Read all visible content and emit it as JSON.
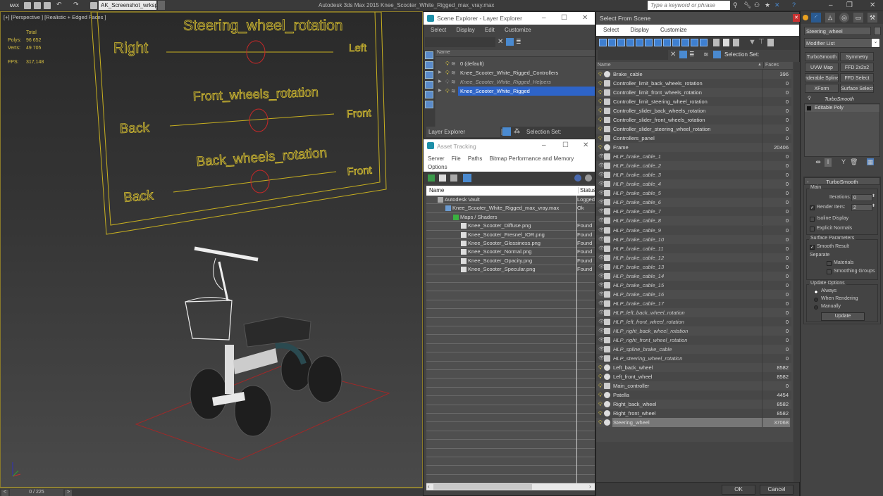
{
  "app": {
    "title": "Autodesk 3ds Max  2015    Knee_Scooter_White_Rigged_max_vray.max",
    "workspace": "AK_Screenshot_wrksp",
    "search_placeholder": "Type a keyword or phrase",
    "logo_text": "MAX"
  },
  "viewport": {
    "label": "[+] [Perspective ] [Realistic + Edged Faces ]",
    "stats": {
      "header": "Total",
      "polys_label": "Polys:",
      "polys": "96 652",
      "verts_label": "Verts:",
      "verts": "49 705",
      "fps_label": "FPS:",
      "fps": "317,148"
    },
    "panel": {
      "steering_title": "Steering_wheel_rotation",
      "steering_left": "Right",
      "steering_right": "Left",
      "front_title": "Front_wheels_rotation",
      "front_left": "Back",
      "front_right": "Front",
      "back_title": "Back_wheels_rotation",
      "back_left": "Back",
      "back_right": "Front"
    },
    "timeline": {
      "frame": "0 / 225",
      "prev": "<",
      "next": ">"
    }
  },
  "scene_explorer": {
    "title": "Scene Explorer - Layer Explorer",
    "menu": [
      "Select",
      "Display",
      "Edit",
      "Customize"
    ],
    "column_name": "Name",
    "layers": [
      {
        "name": "0 (default)",
        "expandable": false,
        "hidden": false,
        "selected": false
      },
      {
        "name": "Knee_Scooter_White_Rigged_Controllers",
        "expandable": true,
        "hidden": false,
        "selected": false
      },
      {
        "name": "Knee_Scooter_White_Rigged_Helpers",
        "expandable": true,
        "hidden": true,
        "selected": false
      },
      {
        "name": "Knee_Scooter_White_Rigged",
        "expandable": true,
        "hidden": false,
        "selected": true
      }
    ],
    "footer_mode": "Layer Explorer",
    "footer_selset": "Selection Set:"
  },
  "asset_tracking": {
    "title": "Asset Tracking",
    "menu": [
      "Server",
      "File",
      "Paths",
      "Bitmap Performance and Memory",
      "Options"
    ],
    "columns": [
      "Name",
      "Status"
    ],
    "rows": [
      {
        "name": "Autodesk Vault",
        "status": "Logged",
        "indent": 0,
        "icon": "vault"
      },
      {
        "name": "Knee_Scooter_White_Rigged_max_vray.max",
        "status": "Ok",
        "indent": 1,
        "icon": "max-file"
      },
      {
        "name": "Maps / Shaders",
        "status": "",
        "indent": 2,
        "icon": "folder"
      },
      {
        "name": "Knee_Scooter_Diffuse.png",
        "status": "Found",
        "indent": 3,
        "icon": "image"
      },
      {
        "name": "Knee_Scooter_Fresnel_IOR.png",
        "status": "Found",
        "indent": 3,
        "icon": "image"
      },
      {
        "name": "Knee_Scooter_Glossiness.png",
        "status": "Found",
        "indent": 3,
        "icon": "image"
      },
      {
        "name": "Knee_Scooter_Normal.png",
        "status": "Found",
        "indent": 3,
        "icon": "image"
      },
      {
        "name": "Knee_Scooter_Opacity.png",
        "status": "Found",
        "indent": 3,
        "icon": "image"
      },
      {
        "name": "Knee_Scooter_Specular.png",
        "status": "Found",
        "indent": 3,
        "icon": "image"
      }
    ]
  },
  "select_from_scene": {
    "title": "Select From Scene",
    "menu": [
      "Select",
      "Display",
      "Customize"
    ],
    "selection_set_label": "Selection Set:",
    "columns": [
      "Name",
      "Faces"
    ],
    "objects": [
      {
        "name": "Brake_cable",
        "faces": "396",
        "type": "geometry"
      },
      {
        "name": "Controller_limit_back_wheels_rotation",
        "faces": "0",
        "type": "shape"
      },
      {
        "name": "Controller_limit_front_wheels_rotation",
        "faces": "0",
        "type": "shape"
      },
      {
        "name": "Controller_limit_steering_wheel_rotation",
        "faces": "0",
        "type": "shape"
      },
      {
        "name": "Controller_slider_back_wheels_rotation",
        "faces": "0",
        "type": "shape"
      },
      {
        "name": "Controller_slider_front_wheels_rotation",
        "faces": "0",
        "type": "shape"
      },
      {
        "name": "Controller_slider_steering_wheel_rotation",
        "faces": "0",
        "type": "shape"
      },
      {
        "name": "Controllers_panel",
        "faces": "0",
        "type": "shape"
      },
      {
        "name": "Frame",
        "faces": "20406",
        "type": "geometry"
      },
      {
        "name": "HLP_brake_cable_1",
        "faces": "0",
        "type": "helper"
      },
      {
        "name": "HLP_brake_cable_2",
        "faces": "0",
        "type": "helper"
      },
      {
        "name": "HLP_brake_cable_3",
        "faces": "0",
        "type": "helper"
      },
      {
        "name": "HLP_brake_cable_4",
        "faces": "0",
        "type": "helper"
      },
      {
        "name": "HLP_brake_cable_5",
        "faces": "0",
        "type": "helper"
      },
      {
        "name": "HLP_brake_cable_6",
        "faces": "0",
        "type": "helper"
      },
      {
        "name": "HLP_brake_cable_7",
        "faces": "0",
        "type": "helper"
      },
      {
        "name": "HLP_brake_cable_8",
        "faces": "0",
        "type": "helper"
      },
      {
        "name": "HLP_brake_cable_9",
        "faces": "0",
        "type": "helper"
      },
      {
        "name": "HLP_brake_cable_10",
        "faces": "0",
        "type": "helper"
      },
      {
        "name": "HLP_brake_cable_11",
        "faces": "0",
        "type": "helper"
      },
      {
        "name": "HLP_brake_cable_12",
        "faces": "0",
        "type": "helper"
      },
      {
        "name": "HLP_brake_cable_13",
        "faces": "0",
        "type": "helper"
      },
      {
        "name": "HLP_brake_cable_14",
        "faces": "0",
        "type": "helper"
      },
      {
        "name": "HLP_brake_cable_15",
        "faces": "0",
        "type": "helper"
      },
      {
        "name": "HLP_brake_cable_16",
        "faces": "0",
        "type": "helper"
      },
      {
        "name": "HLP_brake_cable_17",
        "faces": "0",
        "type": "helper"
      },
      {
        "name": "HLP_left_back_wheel_rotation",
        "faces": "0",
        "type": "helper"
      },
      {
        "name": "HLP_left_front_wheel_rotation",
        "faces": "0",
        "type": "helper"
      },
      {
        "name": "HLP_right_back_wheel_rotation",
        "faces": "0",
        "type": "helper"
      },
      {
        "name": "HLP_right_front_wheel_rotation",
        "faces": "0",
        "type": "helper"
      },
      {
        "name": "HLP_spline_brake_cable",
        "faces": "0",
        "type": "helper"
      },
      {
        "name": "HLP_steering_wheel_rotation",
        "faces": "0",
        "type": "helper"
      },
      {
        "name": "Left_back_wheel",
        "faces": "8582",
        "type": "geometry"
      },
      {
        "name": "Left_front_wheel",
        "faces": "8582",
        "type": "geometry"
      },
      {
        "name": "Main_controller",
        "faces": "0",
        "type": "shape"
      },
      {
        "name": "Patella",
        "faces": "4454",
        "type": "geometry"
      },
      {
        "name": "Right_back_wheel",
        "faces": "8582",
        "type": "geometry"
      },
      {
        "name": "Right_front_wheel",
        "faces": "8582",
        "type": "geometry"
      },
      {
        "name": "Steering_wheel",
        "faces": "37068",
        "type": "geometry",
        "selected": true
      }
    ],
    "ok": "OK",
    "cancel": "Cancel"
  },
  "command_panel": {
    "object_name": "Steering_wheel",
    "modifier_list": "Modifier List",
    "modifier_buttons": [
      "TurboSmooth",
      "Symmetry",
      "UVW Map",
      "FFD 2x2x2",
      "Renderable Spline",
      "FFD Select",
      "XForm",
      "Surface Select"
    ],
    "stack": [
      {
        "name": "TurboSmooth",
        "active": true
      },
      {
        "name": "Editable Poly",
        "active": false
      }
    ],
    "turbosmooth": {
      "title": "TurboSmooth",
      "main_label": "Main",
      "iterations_label": "Iterations:",
      "iterations": "0",
      "render_iters_label": "Render Iters:",
      "render_iters": "2",
      "render_iters_checked": true,
      "isoline_label": "Isoline Display",
      "isoline_checked": false,
      "explicit_normals_label": "Explicit Normals",
      "explicit_normals_checked": false,
      "surface_label": "Surface Parameters",
      "smooth_result_label": "Smooth Result",
      "smooth_result_checked": true,
      "separate_label": "Separate",
      "materials_label": "Materials",
      "smoothing_groups_label": "Smoothing Groups",
      "update_label": "Update Options",
      "update_options": [
        "Always",
        "When Rendering",
        "Manually"
      ],
      "update_selected": "Always",
      "update_button": "Update"
    }
  }
}
